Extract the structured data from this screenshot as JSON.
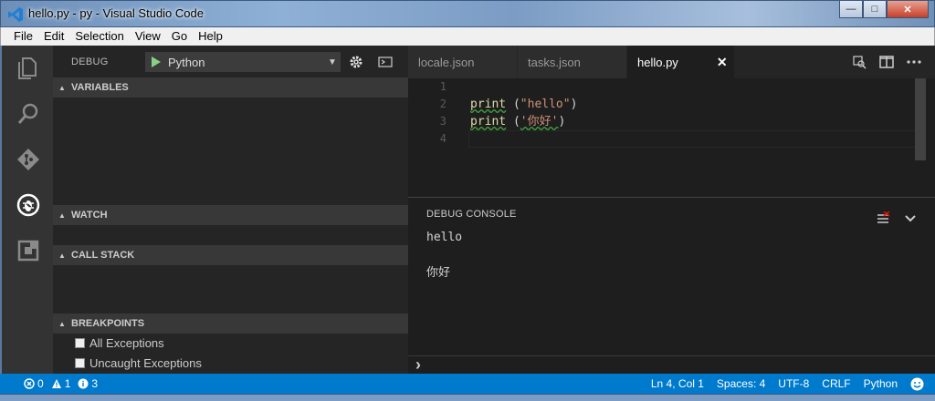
{
  "window": {
    "title": "hello.py - py - Visual Studio Code",
    "minimize_glyph": "—",
    "maximize_glyph": "□",
    "close_glyph": "✕"
  },
  "menu": [
    "File",
    "Edit",
    "Selection",
    "View",
    "Go",
    "Help"
  ],
  "activity_bar": [
    "explorer-icon",
    "search-icon",
    "git-icon",
    "debug-icon",
    "extensions-icon"
  ],
  "debug": {
    "title": "DEBUG",
    "config": "Python",
    "sections": {
      "variables": "VARIABLES",
      "watch": "WATCH",
      "call_stack": "CALL STACK",
      "breakpoints": "BREAKPOINTS"
    },
    "breakpoints": [
      "All Exceptions",
      "Uncaught Exceptions"
    ]
  },
  "tabs": [
    {
      "label": "locale.json",
      "active": false
    },
    {
      "label": "tasks.json",
      "active": false
    },
    {
      "label": "hello.py",
      "active": true
    }
  ],
  "editor": {
    "line_numbers": [
      "1",
      "2",
      "3",
      "4"
    ],
    "lines": [
      {
        "kw": "",
        "rest": "",
        "str": "",
        "end": ""
      },
      {
        "kw": "print",
        "rest": " (",
        "str": "\"hello\"",
        "end": ")"
      },
      {
        "kw": "print",
        "rest": " (",
        "str": "'你好'",
        "end": ")"
      },
      {
        "kw": "",
        "rest": "",
        "str": "",
        "end": ""
      }
    ]
  },
  "panel": {
    "title": "DEBUG CONSOLE",
    "output": [
      "hello",
      "你好"
    ],
    "prompt": "›"
  },
  "status": {
    "errors": "0",
    "warnings": "1",
    "info": "3",
    "position": "Ln 4, Col 1",
    "spaces": "Spaces: 4",
    "encoding": "UTF-8",
    "eol": "CRLF",
    "language": "Python"
  },
  "colors": {
    "accent": "#007acc",
    "keyword": "#dcdcaa",
    "string": "#ce9178"
  }
}
